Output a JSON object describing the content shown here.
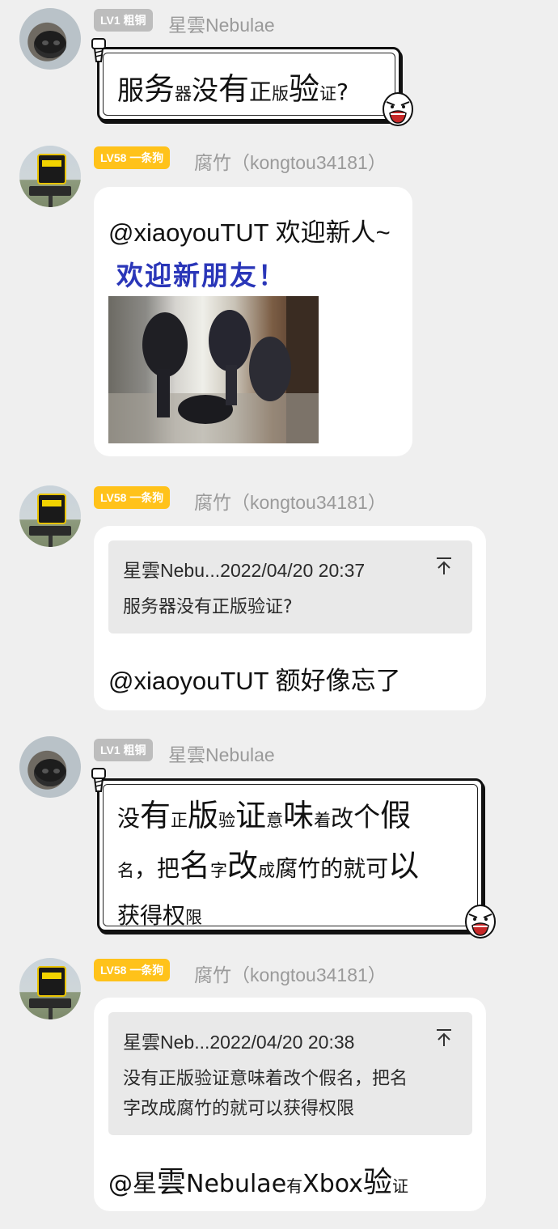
{
  "messages": [
    {
      "level": "LV1 粗铜",
      "name": "星雲Nebulae"
    },
    {
      "level": "LV58 一条狗",
      "name": "腐竹（kongtou34181）",
      "text": "@xiaoyouTUT 欢迎新人~",
      "image_caption": "欢迎新朋友！"
    },
    {
      "level": "LV58 一条狗",
      "name": "腐竹（kongtou34181）",
      "quote_head": "星雲Nebu...2022/04/20 20:37",
      "quote_body": "服务器没有正版验证?",
      "text": "@xiaoyouTUT 额好像忘了"
    },
    {
      "level": "LV1 粗铜",
      "name": "星雲Nebulae"
    },
    {
      "level": "LV58 一条狗",
      "name": "腐竹（kongtou34181）",
      "quote_head": "星雲Neb...2022/04/20 20:38",
      "quote_body_1": "没有正版验证意味着改个假名，把名",
      "quote_body_2": "字改成腐竹的就可以获得权限"
    }
  ],
  "rage_text_1": [
    "服",
    "务",
    "器",
    "没",
    "有",
    "正",
    "版",
    "验",
    "证",
    "?"
  ],
  "rage_text_2": [
    "没",
    "有",
    "正",
    "版",
    "验",
    "证",
    "意",
    "味",
    "着",
    "改",
    "个",
    "假",
    "名",
    "，",
    "把",
    "名",
    "字",
    "改",
    "成",
    "腐",
    "竹",
    "的",
    "就",
    "可",
    "以",
    "获",
    "得",
    "权",
    "限"
  ],
  "mention_3": [
    "@星",
    "雲",
    "Nebulae",
    "有",
    "Xbox",
    "验",
    "证"
  ],
  "colors": {
    "bg": "#efefef",
    "gold_badge": "#ffc21a",
    "grey_badge": "#bdbdbd",
    "welcome_blue": "#2a36b8"
  },
  "icons": {
    "scroll_top": "arrow-to-top-icon",
    "rage_face": "rage-face-icon",
    "screw": "screw-icon"
  }
}
